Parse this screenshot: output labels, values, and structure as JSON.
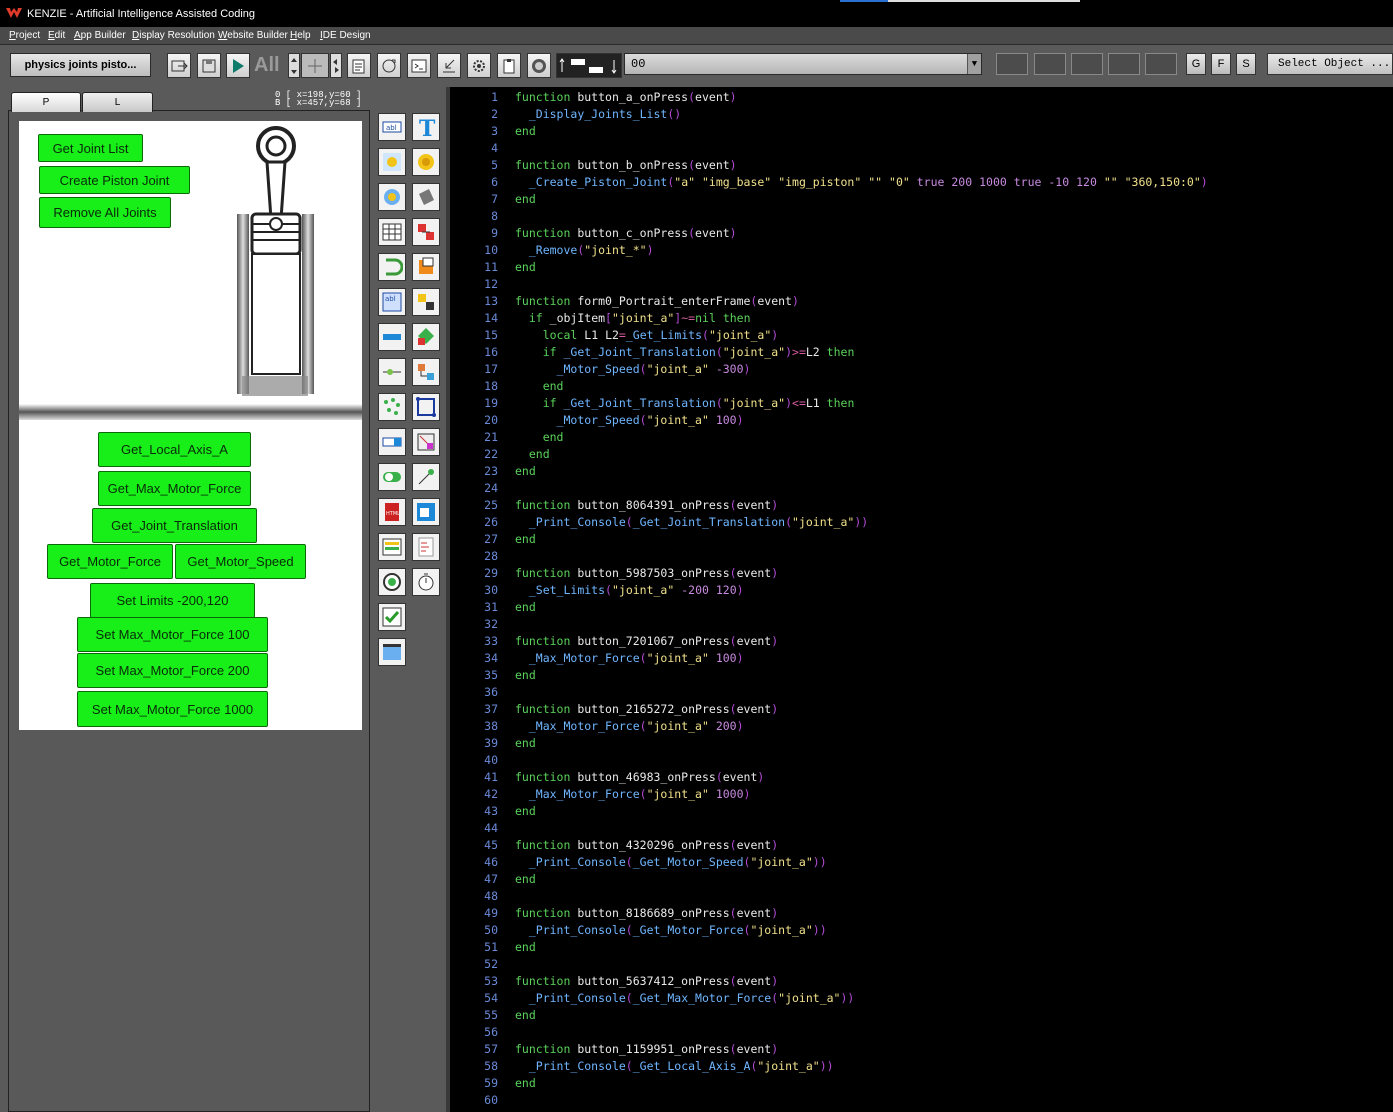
{
  "window": {
    "title": "KENZIE - Artificial Intelligence Assisted Coding"
  },
  "menu": [
    "Project",
    "Edit",
    "App Builder",
    "Display Resolution",
    "Website Builder",
    "Help",
    "IDE Design"
  ],
  "toolbar": {
    "project_name": "physics joints pisto...",
    "all_label": "All",
    "combo_value": "00",
    "letters": [
      "G",
      "F",
      "S"
    ],
    "select_object": "Select Object ..."
  },
  "panel": {
    "tabs": [
      "P",
      "L"
    ],
    "coords": "0 [ x=198,y=60 ]\nB [ x=457,y=68 ]"
  },
  "canvas1_buttons": [
    "Get Joint List",
    "Create Piston Joint",
    "Remove All Joints"
  ],
  "canvas2_buttons": [
    "Get_Local_Axis_A",
    "Get_Max_Motor_Force",
    "Get_Joint_Translation",
    "Get_Motor_Force",
    "Get_Motor_Speed",
    "Set Limits -200,120",
    "Set Max_Motor_Force 100",
    "Set Max_Motor_Force 200",
    "Set Max_Motor_Force 1000"
  ],
  "palette_icons": [
    "textbox-icon",
    "text-icon",
    "image-icon",
    "sprite-icon",
    "animated-image-icon",
    "shape-icon",
    "grid-icon",
    "physics-icon",
    "progress-icon",
    "layer-icon",
    "textarea-icon",
    "group-icon",
    "button-icon",
    "move-icon",
    "slider-icon",
    "path-icon",
    "particles-icon",
    "resize-icon",
    "spinner-icon",
    "mask-icon",
    "switch-icon",
    "rotate-icon",
    "html-icon",
    "webview-icon",
    "list-icon",
    "document-icon",
    "radio-icon",
    "timer-icon",
    "checkbox-icon",
    "video-icon"
  ],
  "code_lines": [
    "<k>function</k> <f>button_a_onPress</f><p>(</p><f>event</f><p>)</p>",
    "  <b>_Display_Joints_List</b><p>()</p>",
    "<k>end</k>",
    "",
    "<k>function</k> <f>button_b_onPress</f><p>(</p><f>event</f><p>)</p>",
    "  <b>_Create_Piston_Joint</b><p>(</p><s>\"a\"</s>,<s>\"img_base\"</s>,<s>\"img_piston\"</s>,<s>\"\"</s>,<s>\"0\"</s>,<n>true</n>,<n>200</n>,<n>1000</n>,<n>true</n>,<n>-10</n>,<n>120</n>,<s>\"\"</s>,<s>\"360,150:0\"</s><p>)</p>",
    "<k>end</k>",
    "",
    "<k>function</k> <f>button_c_onPress</f><p>(</p><f>event</f><p>)</p>",
    "  <b>_Remove</b><p>(</p><s>\"joint_*\"</s><p>)</p>",
    "<k>end</k>",
    "",
    "<k>function</k> <f>form0_Portrait_enterFrame</f><p>(</p><f>event</f><p>)</p>",
    "  <k>if</k> <f>_objItem</f><p>[</p><s>\"joint_a\"</s><p>]</p><o>~=</o><k>nil</k> <k>then</k>",
    "    <k>local</k> <f>L1</f>,<f>L2</f><o>=</o><b>_Get_Limits</b><p>(</p><s>\"joint_a\"</s><p>)</p>",
    "    <k>if</k> <b>_Get_Joint_Translation</b><p>(</p><s>\"joint_a\"</s><p>)</p><o>&gt;=</o><f>L2</f> <k>then</k>",
    "      <b>_Motor_Speed</b><p>(</p><s>\"joint_a\"</s>,<n>-300</n><p>)</p>",
    "    <k>end</k>",
    "    <k>if</k> <b>_Get_Joint_Translation</b><p>(</p><s>\"joint_a\"</s><p>)</p><o>&lt;=</o><f>L1</f> <k>then</k>",
    "      <b>_Motor_Speed</b><p>(</p><s>\"joint_a\"</s>,<n>100</n><p>)</p>",
    "    <k>end</k>",
    "  <k>end</k>",
    "<k>end</k>",
    "",
    "<k>function</k> <f>button_8064391_onPress</f><p>(</p><f>event</f><p>)</p>",
    "  <b>_Print_Console</b><p>(</p><b>_Get_Joint_Translation</b><p>(</p><s>\"joint_a\"</s><p>))</p>",
    "<k>end</k>",
    "",
    "<k>function</k> <f>button_5987503_onPress</f><p>(</p><f>event</f><p>)</p>",
    "  <b>_Set_Limits</b><p>(</p><s>\"joint_a\"</s>,<n>-200</n>,<n>120</n><p>)</p>",
    "<k>end</k>",
    "",
    "<k>function</k> <f>button_7201067_onPress</f><p>(</p><f>event</f><p>)</p>",
    "  <b>_Max_Motor_Force</b><p>(</p><s>\"joint_a\"</s>,<n>100</n><p>)</p>",
    "<k>end</k>",
    "",
    "<k>function</k> <f>button_2165272_onPress</f><p>(</p><f>event</f><p>)</p>",
    "  <b>_Max_Motor_Force</b><p>(</p><s>\"joint_a\"</s>,<n>200</n><p>)</p>",
    "<k>end</k>",
    "",
    "<k>function</k> <f>button_46983_onPress</f><p>(</p><f>event</f><p>)</p>",
    "  <b>_Max_Motor_Force</b><p>(</p><s>\"joint_a\"</s>,<n>1000</n><p>)</p>",
    "<k>end</k>",
    "",
    "<k>function</k> <f>button_4320296_onPress</f><p>(</p><f>event</f><p>)</p>",
    "  <b>_Print_Console</b><p>(</p><b>_Get_Motor_Speed</b><p>(</p><s>\"joint_a\"</s><p>))</p>",
    "<k>end</k>",
    "",
    "<k>function</k> <f>button_8186689_onPress</f><p>(</p><f>event</f><p>)</p>",
    "  <b>_Print_Console</b><p>(</p><b>_Get_Motor_Force</b><p>(</p><s>\"joint_a\"</s><p>))</p>",
    "<k>end</k>",
    "",
    "<k>function</k> <f>button_5637412_onPress</f><p>(</p><f>event</f><p>)</p>",
    "  <b>_Print_Console</b><p>(</p><b>_Get_Max_Motor_Force</b><p>(</p><s>\"joint_a\"</s><p>))</p>",
    "<k>end</k>",
    "",
    "<k>function</k> <f>button_1159951_onPress</f><p>(</p><f>event</f><p>)</p>",
    "  <b>_Print_Console</b><p>(</p><b>_Get_Local_Axis_A</b><p>(</p><s>\"joint_a\"</s><p>))</p>",
    "<k>end</k>",
    ""
  ],
  "colors": {
    "keyword": "#5ad25a",
    "builtin": "#6fb6ff",
    "string": "#f0e08a",
    "number": "#c88ae0",
    "paren": "#b34bd6",
    "line_number": "#6a8ad8",
    "button_green": "#18ef18"
  }
}
